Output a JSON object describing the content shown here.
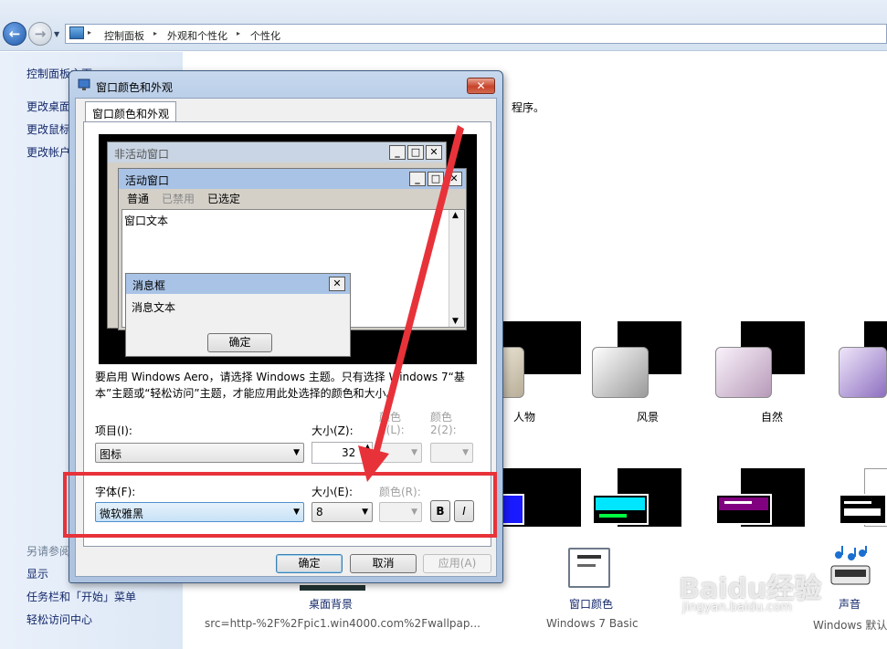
{
  "explorer": {
    "breadcrumbs": [
      "控制面板",
      "外观和个性化",
      "个性化"
    ],
    "left_links": [
      "控制面板主页",
      "更改桌面图标",
      "更改鼠标指针",
      "更改帐户图片"
    ],
    "see_also_title": "另请参阅",
    "see_also_links": [
      "显示",
      "任务栏和「开始」菜单",
      "轻松访问中心"
    ],
    "main_description_tail": "程序。",
    "aero_themes": [
      "人物",
      "风景",
      "自然"
    ],
    "bottom_items": {
      "desktop_background_label": "桌面背景",
      "desktop_background_sub": "src=http-%2F%2Fpic1.win4000.com%2Fwallpap...",
      "window_color_label": "窗口颜色",
      "window_color_sub": "Windows 7 Basic",
      "sound_label": "声音",
      "sound_sub": "Windows 默认"
    },
    "watermark": "Baidu经验",
    "watermark_sub": "jingyan.baidu.com"
  },
  "dialog": {
    "title": "窗口颜色和外观",
    "close_glyph": "✕",
    "tab_label": "窗口颜色和外观",
    "preview": {
      "inactive_title": "非活动窗口",
      "active_title": "活动窗口",
      "menu_normal": "普通",
      "menu_disabled": "已禁用",
      "menu_selected": "已选定",
      "window_text": "窗口文本",
      "msgbox_title": "消息框",
      "msgbox_text": "消息文本",
      "msgbox_ok": "确定"
    },
    "info_line1": "要启用 Windows Aero，请选择 Windows 主题。只有选择 Windows 7“基",
    "info_line2": "本”主题或“轻松访问”主题，才能应用此处选择的颜色和大小。",
    "item_label": "项目(I):",
    "item_value": "图标",
    "item_size_label": "大小(Z):",
    "item_size_value": "32",
    "color1_label_a": "颜色",
    "color1_label_b": "1(L):",
    "color2_label_a": "颜色",
    "color2_label_b": "2(2):",
    "font_label": "字体(F):",
    "font_value": "微软雅黑",
    "font_size_label": "大小(E):",
    "font_size_value": "8",
    "font_color_label": "颜色(R):",
    "bold_label": "B",
    "italic_label": "I",
    "ok_button": "确定",
    "cancel_button": "取消",
    "apply_button": "应用(A)"
  },
  "colors": {
    "highlight": "#e8323a",
    "title_active": "#a9c3e6",
    "title_inactive": "#c9d5e4"
  }
}
